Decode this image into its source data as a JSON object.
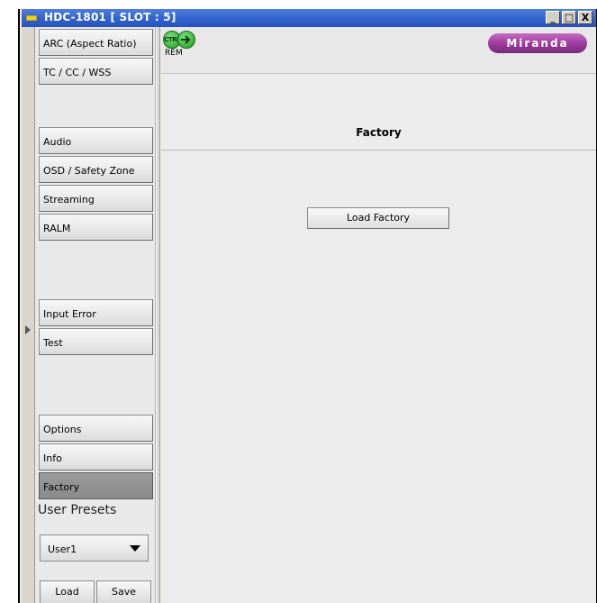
{
  "window": {
    "title": "HDC-1801 [ SLOT : 5]",
    "controls": {
      "minimize": "_",
      "maximize": "□",
      "close": "X"
    }
  },
  "sidebar": {
    "items": [
      {
        "label": "ARC (Aspect Ratio)"
      },
      {
        "label": "TC / CC / WSS"
      },
      {
        "label": "Audio"
      },
      {
        "label": "OSD / Safety Zone"
      },
      {
        "label": "Streaming"
      },
      {
        "label": "RALM"
      },
      {
        "label": "Input Error"
      },
      {
        "label": "Test"
      },
      {
        "label": "Options"
      },
      {
        "label": "Info"
      },
      {
        "label": "Factory",
        "active": true
      }
    ],
    "user_presets": {
      "label": "User Presets",
      "selected": "User1",
      "load_label": "Load",
      "save_label": "Save"
    }
  },
  "toolbar": {
    "ctrl_label": "CTRL",
    "rem_label": "REM",
    "logo_text": "Miranda",
    "logo_color": "#9a3a9a"
  },
  "panel": {
    "title": "Factory",
    "load_factory_label": "Load Factory"
  },
  "colors": {
    "titlebar": "#2f5ecb",
    "active_nav": "#8f8f8f",
    "status_green": "#2aa82a"
  }
}
